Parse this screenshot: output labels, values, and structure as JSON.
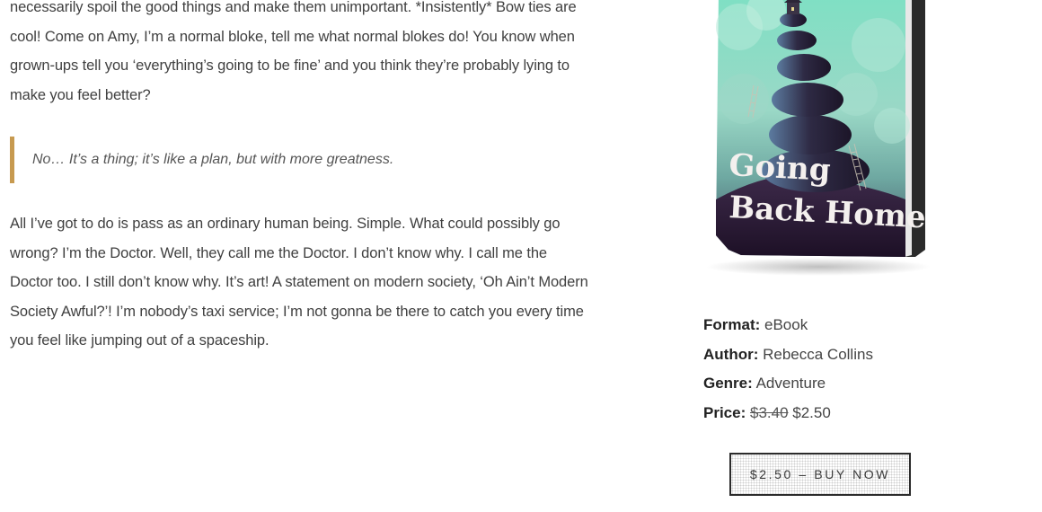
{
  "article": {
    "paragraph_1": "necessarily spoil the good things and make them unimportant. *Insistently* Bow ties are cool! Come on Amy, I’m a normal bloke, tell me what normal blokes do! You know when grown-ups tell you ‘everything’s going to be fine’ and you think they’re probably lying to make you feel better?",
    "quote": "No… It’s a thing; it’s like a plan, but with more greatness.",
    "paragraph_2": "All I’ve got to do is pass as an ordinary human being. Simple. What could possibly go wrong? I’m the Doctor. Well, they call me the Doctor. I don’t know why. I call me the Doctor too. I still don’t know why. It’s art! A statement on modern society, ‘Oh Ain’t Modern Society Awful?’! I’m nobody’s taxi service; I’m not gonna be there to catch you every time you feel like jumping out of a spaceship."
  },
  "book": {
    "cover_title_line1": "Going",
    "cover_title_line2": "Back Home",
    "format_label": "Format:",
    "format_value": "eBook",
    "author_label": "Author:",
    "author_value": "Rebecca Collins",
    "genre_label": "Genre:",
    "genre_value": "Adventure",
    "price_label": "Price:",
    "old_price": "$3.40",
    "new_price": "$2.50"
  },
  "buy_button": {
    "label": "$2.50 – BUY NOW"
  },
  "colors": {
    "quote_border": "#c79a50",
    "cover_dark": "#2a1a36",
    "cover_mint": "#86d8c1"
  }
}
